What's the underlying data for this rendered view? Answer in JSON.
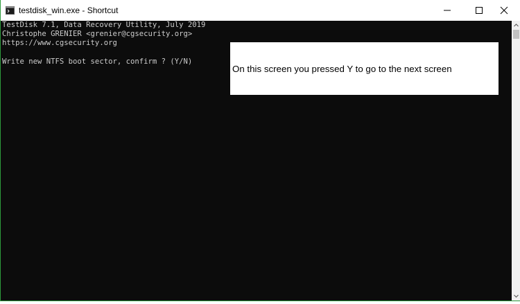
{
  "window": {
    "title": "testdisk_win.exe - Shortcut",
    "accent_color": "#2e9b3c",
    "console_background": "#0c0c0c",
    "console_text_color": "#cccccc"
  },
  "titlebar": {
    "app_icon": "console-app-icon",
    "minimize_icon": "minimize-icon",
    "maximize_icon": "maximize-icon",
    "close_icon": "close-icon"
  },
  "console": {
    "lines": [
      "TestDisk 7.1, Data Recovery Utility, July 2019",
      "Christophe GRENIER <grenier@cgsecurity.org>",
      "https://www.cgsecurity.org",
      "",
      "Write new NTFS boot sector, confirm ? (Y/N)"
    ]
  },
  "annotation": {
    "text": "On this screen you pressed Y to go to the next screen"
  },
  "scrollbar": {
    "up_icon": "scroll-up-arrow-icon",
    "down_icon": "scroll-down-arrow-icon"
  }
}
